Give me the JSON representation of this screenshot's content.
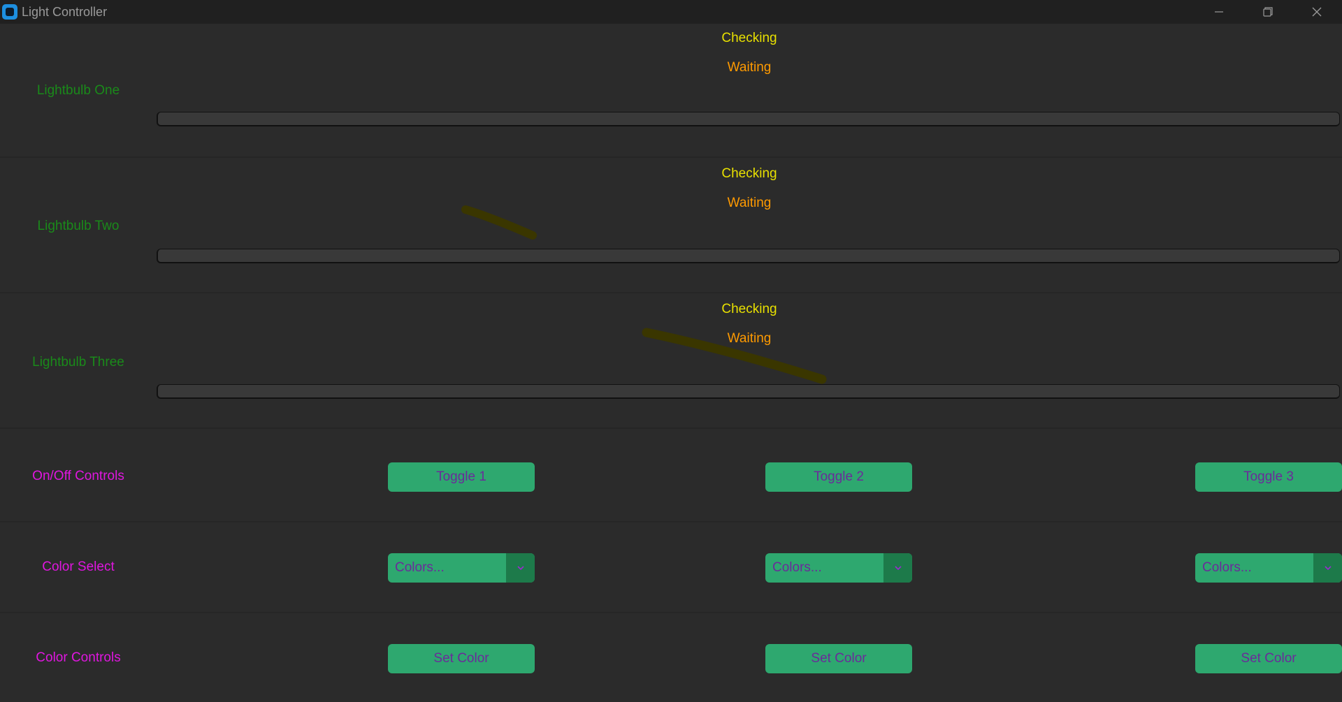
{
  "window": {
    "title": "Light Controller",
    "controls": [
      "minimize-icon",
      "restore-icon",
      "close-icon"
    ]
  },
  "lightbulbs": [
    {
      "name": "Lightbulb One",
      "status": "Checking",
      "state": "Waiting",
      "progress": 0
    },
    {
      "name": "Lightbulb Two",
      "status": "Checking",
      "state": "Waiting",
      "progress": 0
    },
    {
      "name": "Lightbulb Three",
      "status": "Checking",
      "state": "Waiting",
      "progress": 0
    }
  ],
  "controls": {
    "on_off": {
      "label": "On/Off Controls",
      "buttons": [
        "Toggle 1",
        "Toggle 2",
        "Toggle 3"
      ]
    },
    "color_select": {
      "label": "Color Select",
      "dropdowns": [
        "Colors...",
        "Colors...",
        "Colors..."
      ],
      "arrow_icon": "chevron-down-icon"
    },
    "color_controls": {
      "label": "Color Controls",
      "buttons": [
        "Set Color",
        "Set Color",
        "Set Color"
      ]
    }
  },
  "colors": {
    "background": "#2b2b2b",
    "titlebar": "#202020",
    "bulb_label": "#1a8a1a",
    "checking": "#e8e000",
    "waiting": "#ff9a00",
    "control_label": "#e016e0",
    "button_bg": "#2ea86f",
    "button_text": "#6a2b9a",
    "dropdown_arrow_bg": "#1d7a4a"
  }
}
